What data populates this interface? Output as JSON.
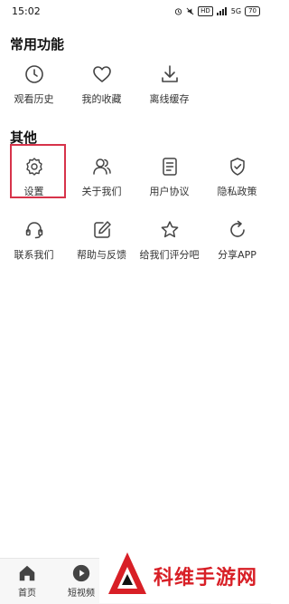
{
  "status_bar": {
    "time": "15:02",
    "network": "5G",
    "hd": "HD",
    "battery": "70"
  },
  "sections": {
    "common": {
      "title": "常用功能"
    },
    "other": {
      "title": "其他"
    }
  },
  "common_items": [
    {
      "label": "观看历史",
      "icon": "clock-icon"
    },
    {
      "label": "我的收藏",
      "icon": "heart-icon"
    },
    {
      "label": "离线缓存",
      "icon": "download-icon"
    }
  ],
  "other_items": [
    {
      "label": "设置",
      "icon": "gear-icon"
    },
    {
      "label": "关于我们",
      "icon": "users-icon"
    },
    {
      "label": "用户协议",
      "icon": "document-icon"
    },
    {
      "label": "隐私政策",
      "icon": "shield-icon"
    },
    {
      "label": "联系我们",
      "icon": "headset-icon"
    },
    {
      "label": "帮助与反馈",
      "icon": "edit-icon"
    },
    {
      "label": "给我们评分吧",
      "icon": "star-icon"
    },
    {
      "label": "分享APP",
      "icon": "share-icon"
    }
  ],
  "bottom_nav": [
    {
      "label": "首页",
      "icon": "home-icon"
    },
    {
      "label": "短视频",
      "icon": "play-icon"
    }
  ],
  "watermark": {
    "text": "科维手游网"
  },
  "colors": {
    "highlight": "#d7334a",
    "watermark": "#d81f26",
    "icon": "#444444"
  }
}
